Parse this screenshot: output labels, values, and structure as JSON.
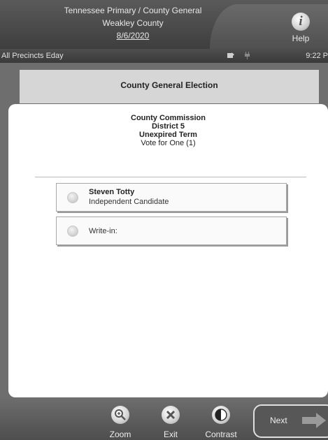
{
  "header": {
    "line1": "Tennessee Primary / County General",
    "line2": "Weakley County",
    "date": "8/6/2020",
    "help_label": "Help",
    "help_glyph": "i"
  },
  "status_bar": {
    "precinct": "All Precincts Eday",
    "time": "9:22 P",
    "icons": [
      "card-icon",
      "plug-icon"
    ]
  },
  "election": {
    "title": "County General Election"
  },
  "contest": {
    "office": "County Commission",
    "district": "District 5",
    "term": "Unexpired Term",
    "instruction": "Vote for One (1)"
  },
  "candidates": [
    {
      "name": "Steven Totty",
      "party": "Independent Candidate",
      "selected": false
    }
  ],
  "write_in": {
    "label": "Write-in:",
    "selected": false
  },
  "footer": {
    "zoom_label": "Zoom",
    "exit_label": "Exit",
    "contrast_label": "Contrast",
    "next_label": "Next"
  },
  "colors": {
    "background": "#6e6e6e",
    "panel": "#ffffff",
    "election_bar": "#d6d6d6"
  }
}
